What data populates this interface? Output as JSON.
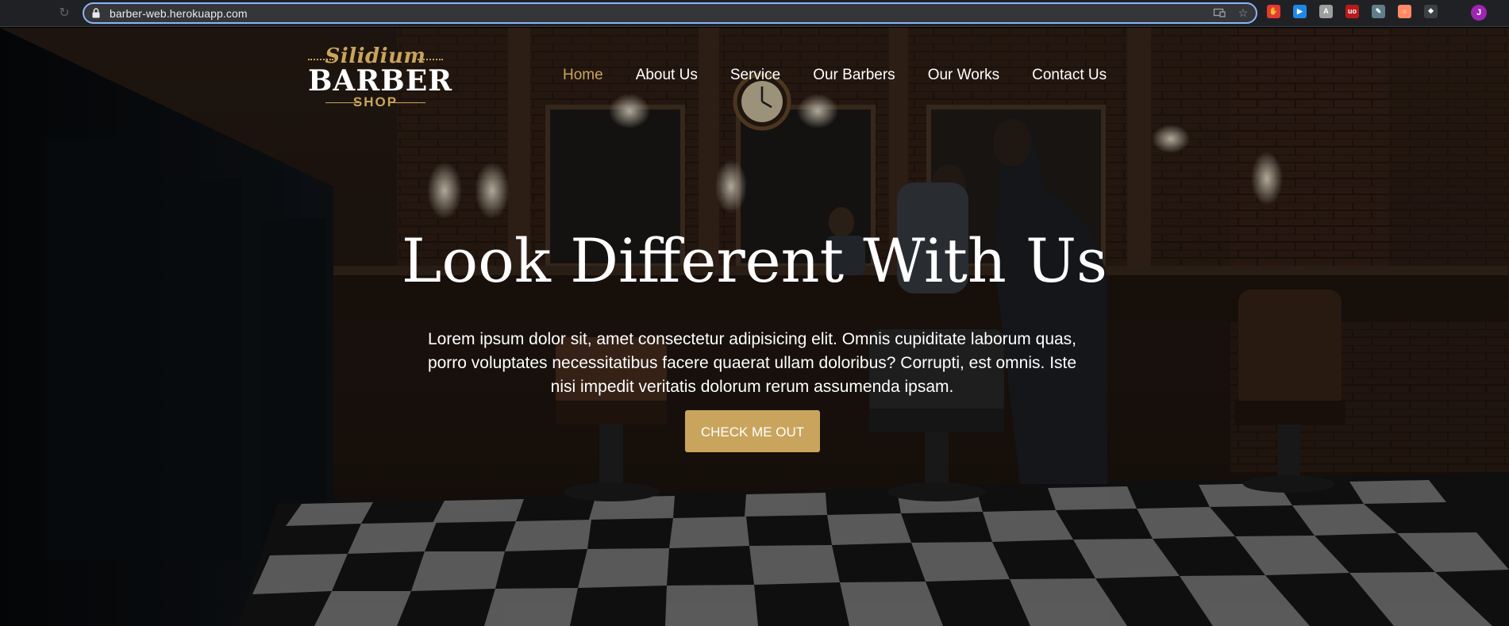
{
  "browser": {
    "url": "barber-web.herokuapp.com",
    "profile_initial": "J",
    "profile_color": "#9c27b0",
    "extensions": [
      {
        "name": "adblock-icon",
        "color": "#e53935",
        "glyph": "✋"
      },
      {
        "name": "screencast-icon",
        "color": "#1e88e5",
        "glyph": "▶"
      },
      {
        "name": "translate-icon",
        "color": "#9e9e9e",
        "glyph": "А"
      },
      {
        "name": "ublock-icon",
        "color": "#b71c1c",
        "glyph": "uo"
      },
      {
        "name": "pen-tool-icon",
        "color": "#607d8b",
        "glyph": "✎"
      },
      {
        "name": "toggle-icon",
        "color": "#ff8a65",
        "glyph": "○"
      },
      {
        "name": "puzzle-icon",
        "color": "#3c4043",
        "glyph": "❖"
      }
    ]
  },
  "logo": {
    "script": "Silidium",
    "main": "BARBER",
    "sub": "SHOP"
  },
  "nav": {
    "items": [
      {
        "label": "Home",
        "active": true
      },
      {
        "label": "About Us",
        "active": false
      },
      {
        "label": "Service",
        "active": false
      },
      {
        "label": "Our Barbers",
        "active": false
      },
      {
        "label": "Our Works",
        "active": false
      },
      {
        "label": "Contact Us",
        "active": false
      }
    ]
  },
  "hero": {
    "title": "Look Different With Us",
    "lead": "Lorem ipsum dolor sit, amet consectetur adipisicing elit. Omnis cupiditate laborum quas, porro voluptates necessitatibus facere quaerat ullam doloribus? Corrupti, est omnis. Iste nisi impedit veritatis dolorum rerum assumenda ipsam.",
    "cta_label": "CHECK ME OUT"
  },
  "colors": {
    "accent": "#c9a45c",
    "text": "#ffffff",
    "chrome": "#202124"
  }
}
